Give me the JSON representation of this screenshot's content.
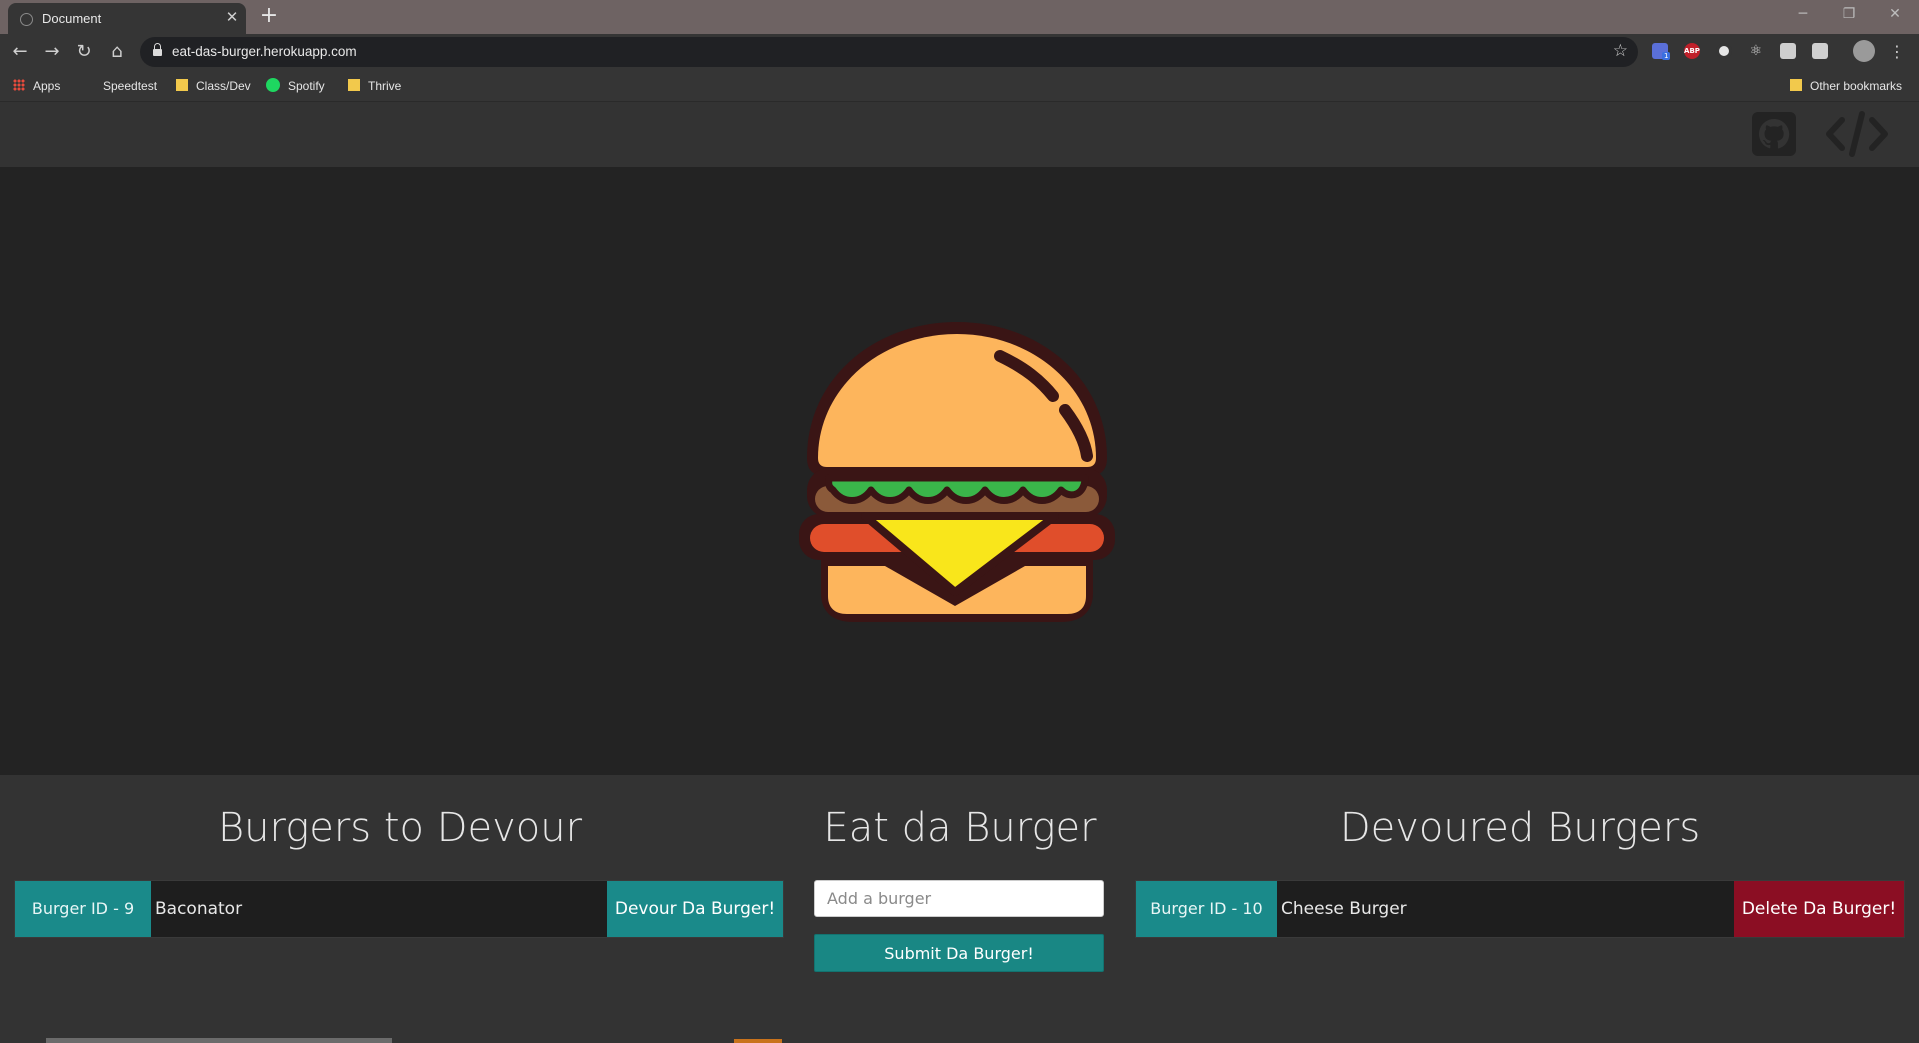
{
  "browser": {
    "tab_title": "Document",
    "url": "eat-das-burger.herokuapp.com",
    "bookmarks": [
      {
        "label": "Apps",
        "icon": "apps-grid-icon"
      },
      {
        "label": "Speedtest",
        "icon": "none"
      },
      {
        "label": "Class/Dev",
        "icon": "folder-icon"
      },
      {
        "label": "Spotify",
        "icon": "spotify-icon"
      },
      {
        "label": "Thrive",
        "icon": "folder-icon"
      }
    ],
    "other_bookmarks": "Other bookmarks",
    "extensions": [
      "extension-badge-icon",
      "adblock-plus-icon",
      "circle-extension-icon",
      "react-devtools-icon",
      "extension-icon",
      "extension-icon"
    ],
    "ext_badge_count": "1",
    "abp_label": "ABP"
  },
  "header": {
    "github_icon": "github-icon",
    "code_icon": "code-icon"
  },
  "hero": {
    "image": "burger-illustration"
  },
  "to_devour": {
    "title": "Burgers to Devour",
    "items": [
      {
        "id_label": "Burger ID - 9",
        "name": "Baconator",
        "button": "Devour Da Burger!"
      }
    ]
  },
  "form": {
    "title": "Eat da Burger",
    "placeholder": "Add a burger",
    "submit_label": "Submit Da Burger!"
  },
  "devoured": {
    "title": "Devoured Burgers",
    "items": [
      {
        "id_label": "Burger ID - 10",
        "name": "Cheese Burger",
        "button": "Delete Da Burger!"
      }
    ]
  },
  "colors": {
    "teal": "#1a8a8a",
    "delete_red": "#8b0e23",
    "hero_bg": "#232323",
    "page_bg": "#333333"
  }
}
